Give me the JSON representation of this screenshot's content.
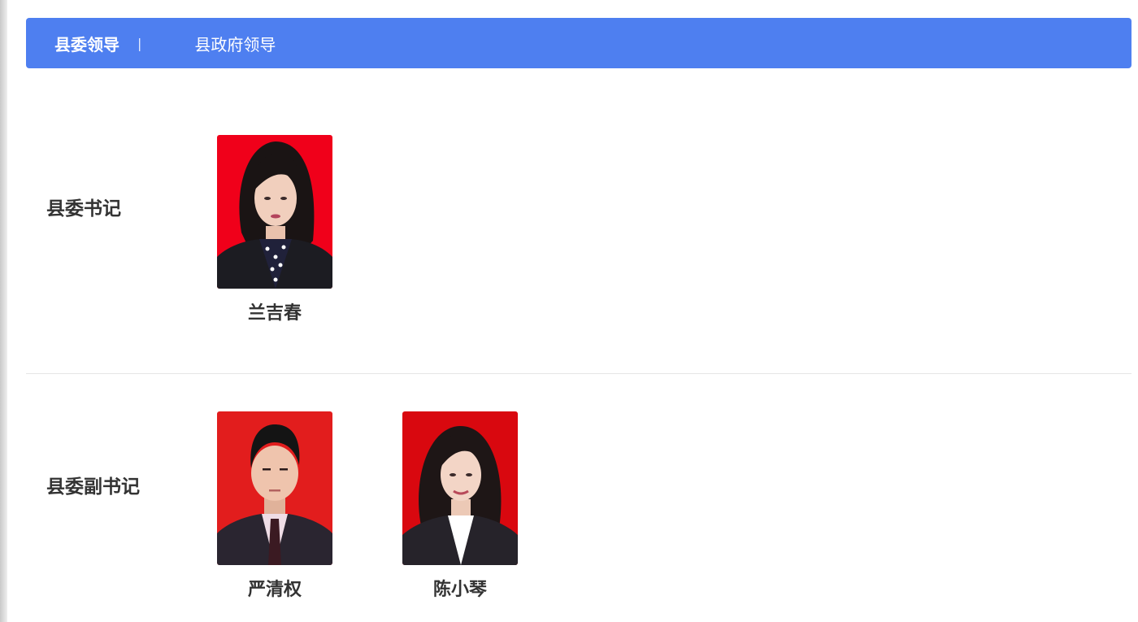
{
  "tabs": {
    "active_label": "县委领导",
    "divider": "|",
    "second_label": "县政府领导"
  },
  "sections": [
    {
      "role": "县委书记",
      "people": [
        {
          "name": "兰吉春"
        }
      ]
    },
    {
      "role": "县委副书记",
      "people": [
        {
          "name": "严清权"
        },
        {
          "name": "陈小琴"
        }
      ]
    }
  ],
  "colors": {
    "tab_bar": "#4e7ff0",
    "photo_background": "#e41c1c",
    "text": "#333333"
  }
}
